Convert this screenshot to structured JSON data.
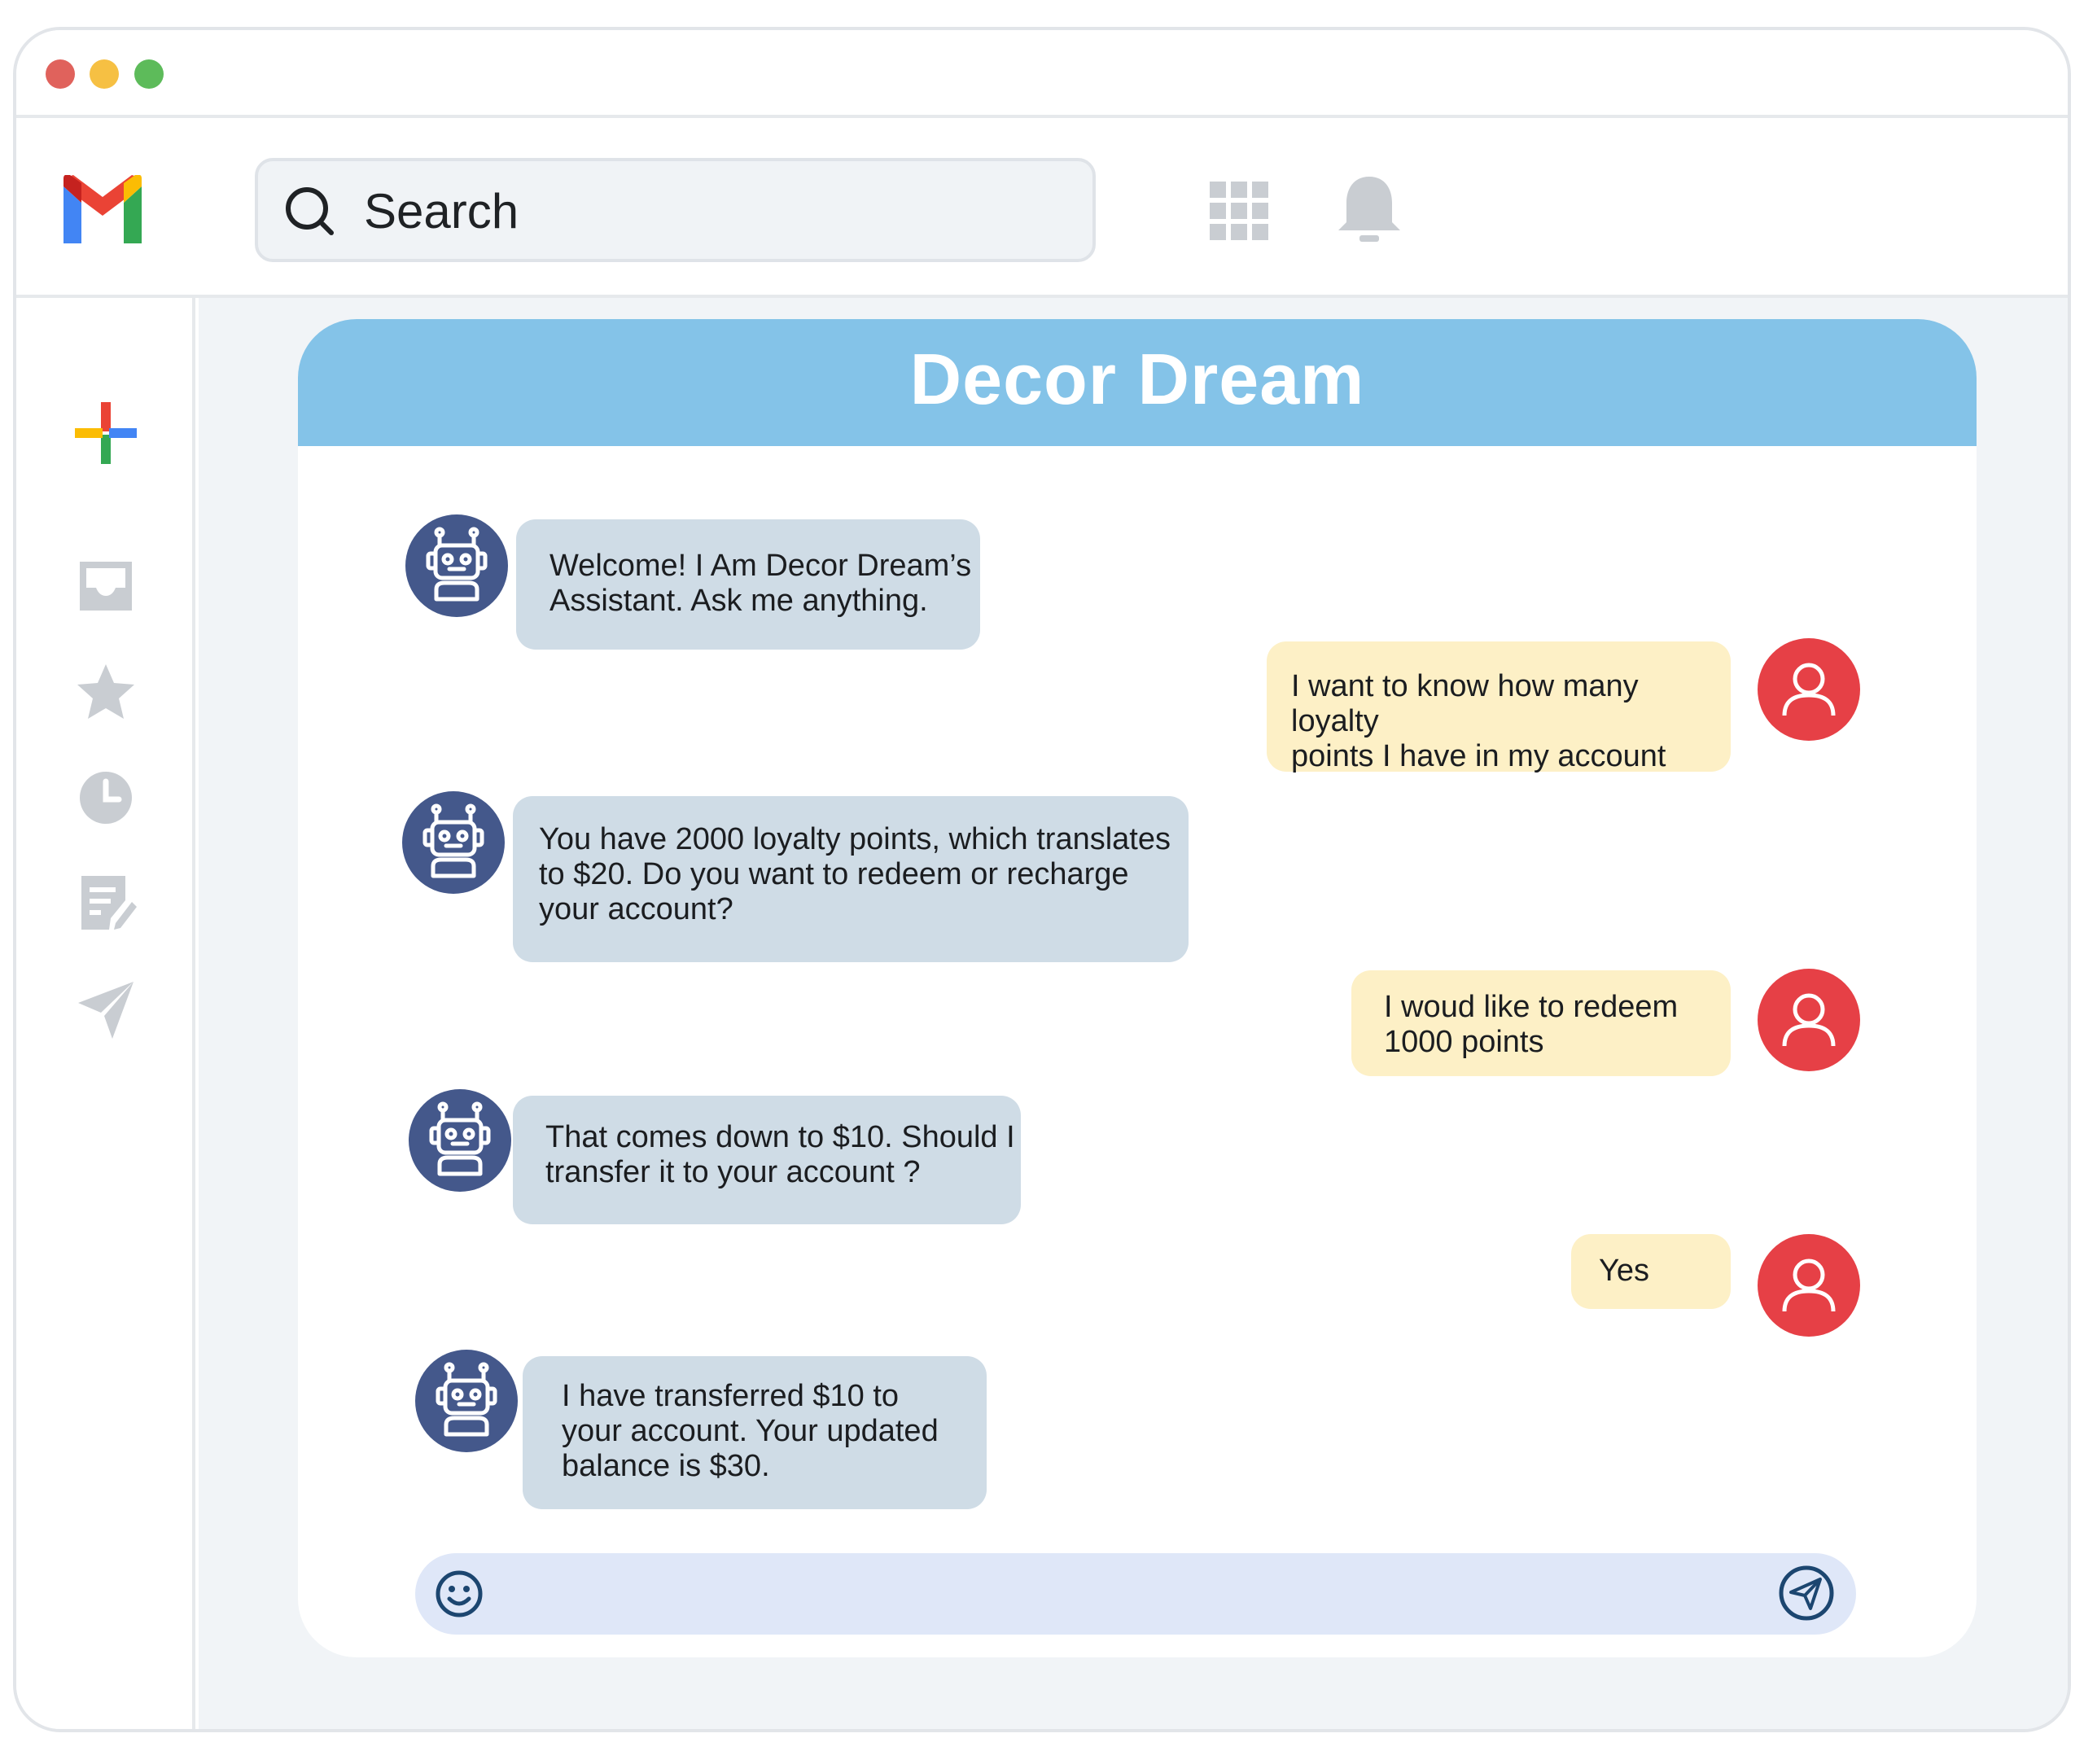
{
  "window": {
    "traffic_lights": {
      "close": "#e0625c",
      "minimize": "#f6c043",
      "maximize": "#5dbb5a"
    }
  },
  "toolbar": {
    "logo_icon": "gmail-logo-icon",
    "search": {
      "text": "Search",
      "icon": "search-icon"
    },
    "apps_icon": "apps-grid-icon",
    "notifications_icon": "bell-icon"
  },
  "sidebar": {
    "items": [
      {
        "icon": "plus-icon"
      },
      {
        "icon": "inbox-icon"
      },
      {
        "icon": "star-icon"
      },
      {
        "icon": "clock-icon"
      },
      {
        "icon": "drafts-icon"
      },
      {
        "icon": "send-icon"
      }
    ]
  },
  "chat": {
    "title": "Decor Dream",
    "header_color": "#84c3e8",
    "bot_bubble_color": "#cfdce6",
    "user_bubble_color": "#fdf0c6",
    "bot_avatar_color": "#44588b",
    "user_avatar_color": "#e64046",
    "messages": [
      {
        "sender": "bot",
        "lines": [
          "Welcome! I Am Decor Dream’s",
          "Assistant. Ask me anything."
        ]
      },
      {
        "sender": "user",
        "lines": [
          "I want to know how many loyalty",
          "points I have in my account"
        ]
      },
      {
        "sender": "bot",
        "lines": [
          "You have 2000 loyalty points, which translates",
          "to $20. Do you want to redeem or recharge",
          "your account?"
        ]
      },
      {
        "sender": "user",
        "lines": [
          "I woud like to redeem",
          "1000 points"
        ]
      },
      {
        "sender": "bot",
        "lines": [
          "That comes down to $10. Should I",
          "transfer it to your account ?"
        ]
      },
      {
        "sender": "user",
        "lines": [
          "Yes"
        ]
      },
      {
        "sender": "bot",
        "lines": [
          "I have transferred $10 to",
          "your account. Your updated",
          "balance is $30."
        ]
      }
    ],
    "input": {
      "value": "",
      "emoji_icon": "emoji-icon",
      "send_icon": "send-plane-icon"
    }
  }
}
